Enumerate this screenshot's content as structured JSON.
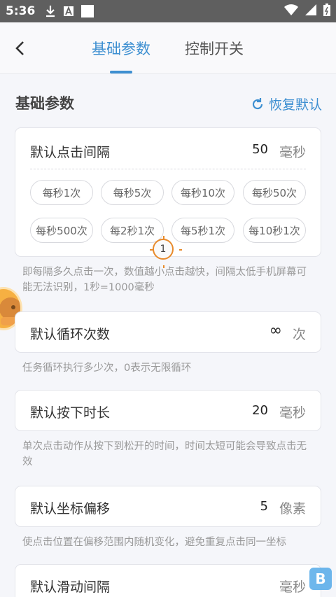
{
  "status_bar": {
    "time": "5:36"
  },
  "header": {
    "tabs": [
      {
        "label": "基础参数",
        "active": true
      },
      {
        "label": "控制开关",
        "active": false
      }
    ]
  },
  "section": {
    "title": "基础参数",
    "restore_label": "恢复默认"
  },
  "click_interval": {
    "label": "默认点击间隔",
    "value": "50",
    "unit": "毫秒",
    "presets": [
      "每秒1次",
      "每秒5次",
      "每秒10次",
      "每秒50次",
      "每秒500次",
      "每2秒1次",
      "每5秒1次",
      "每10秒1次"
    ],
    "description": "即每隔多久点击一次，数值越小点击越快，间隔太低手机屏幕可能无法识别，1秒=1000毫秒"
  },
  "marker_number": "1",
  "loop_count": {
    "label": "默认循环次数",
    "value": "∞",
    "unit": "次",
    "description": "任务循环执行多少次，0表示无限循环"
  },
  "press_duration": {
    "label": "默认按下时长",
    "value": "20",
    "unit": "毫秒",
    "description": "单次点击动作从按下到松开的时间，时间太短可能会导致点击无效"
  },
  "coord_offset": {
    "label": "默认坐标偏移",
    "value": "5",
    "unit": "像素",
    "description": "使点击位置在偏移范围内随机变化，避免重复点击同一坐标"
  },
  "slide_interval": {
    "label": "默认滑动间隔",
    "unit": "毫秒"
  },
  "colors": {
    "accent": "#3d8fd1",
    "background": "#f5f6fa",
    "marker": "#e88a2b"
  }
}
